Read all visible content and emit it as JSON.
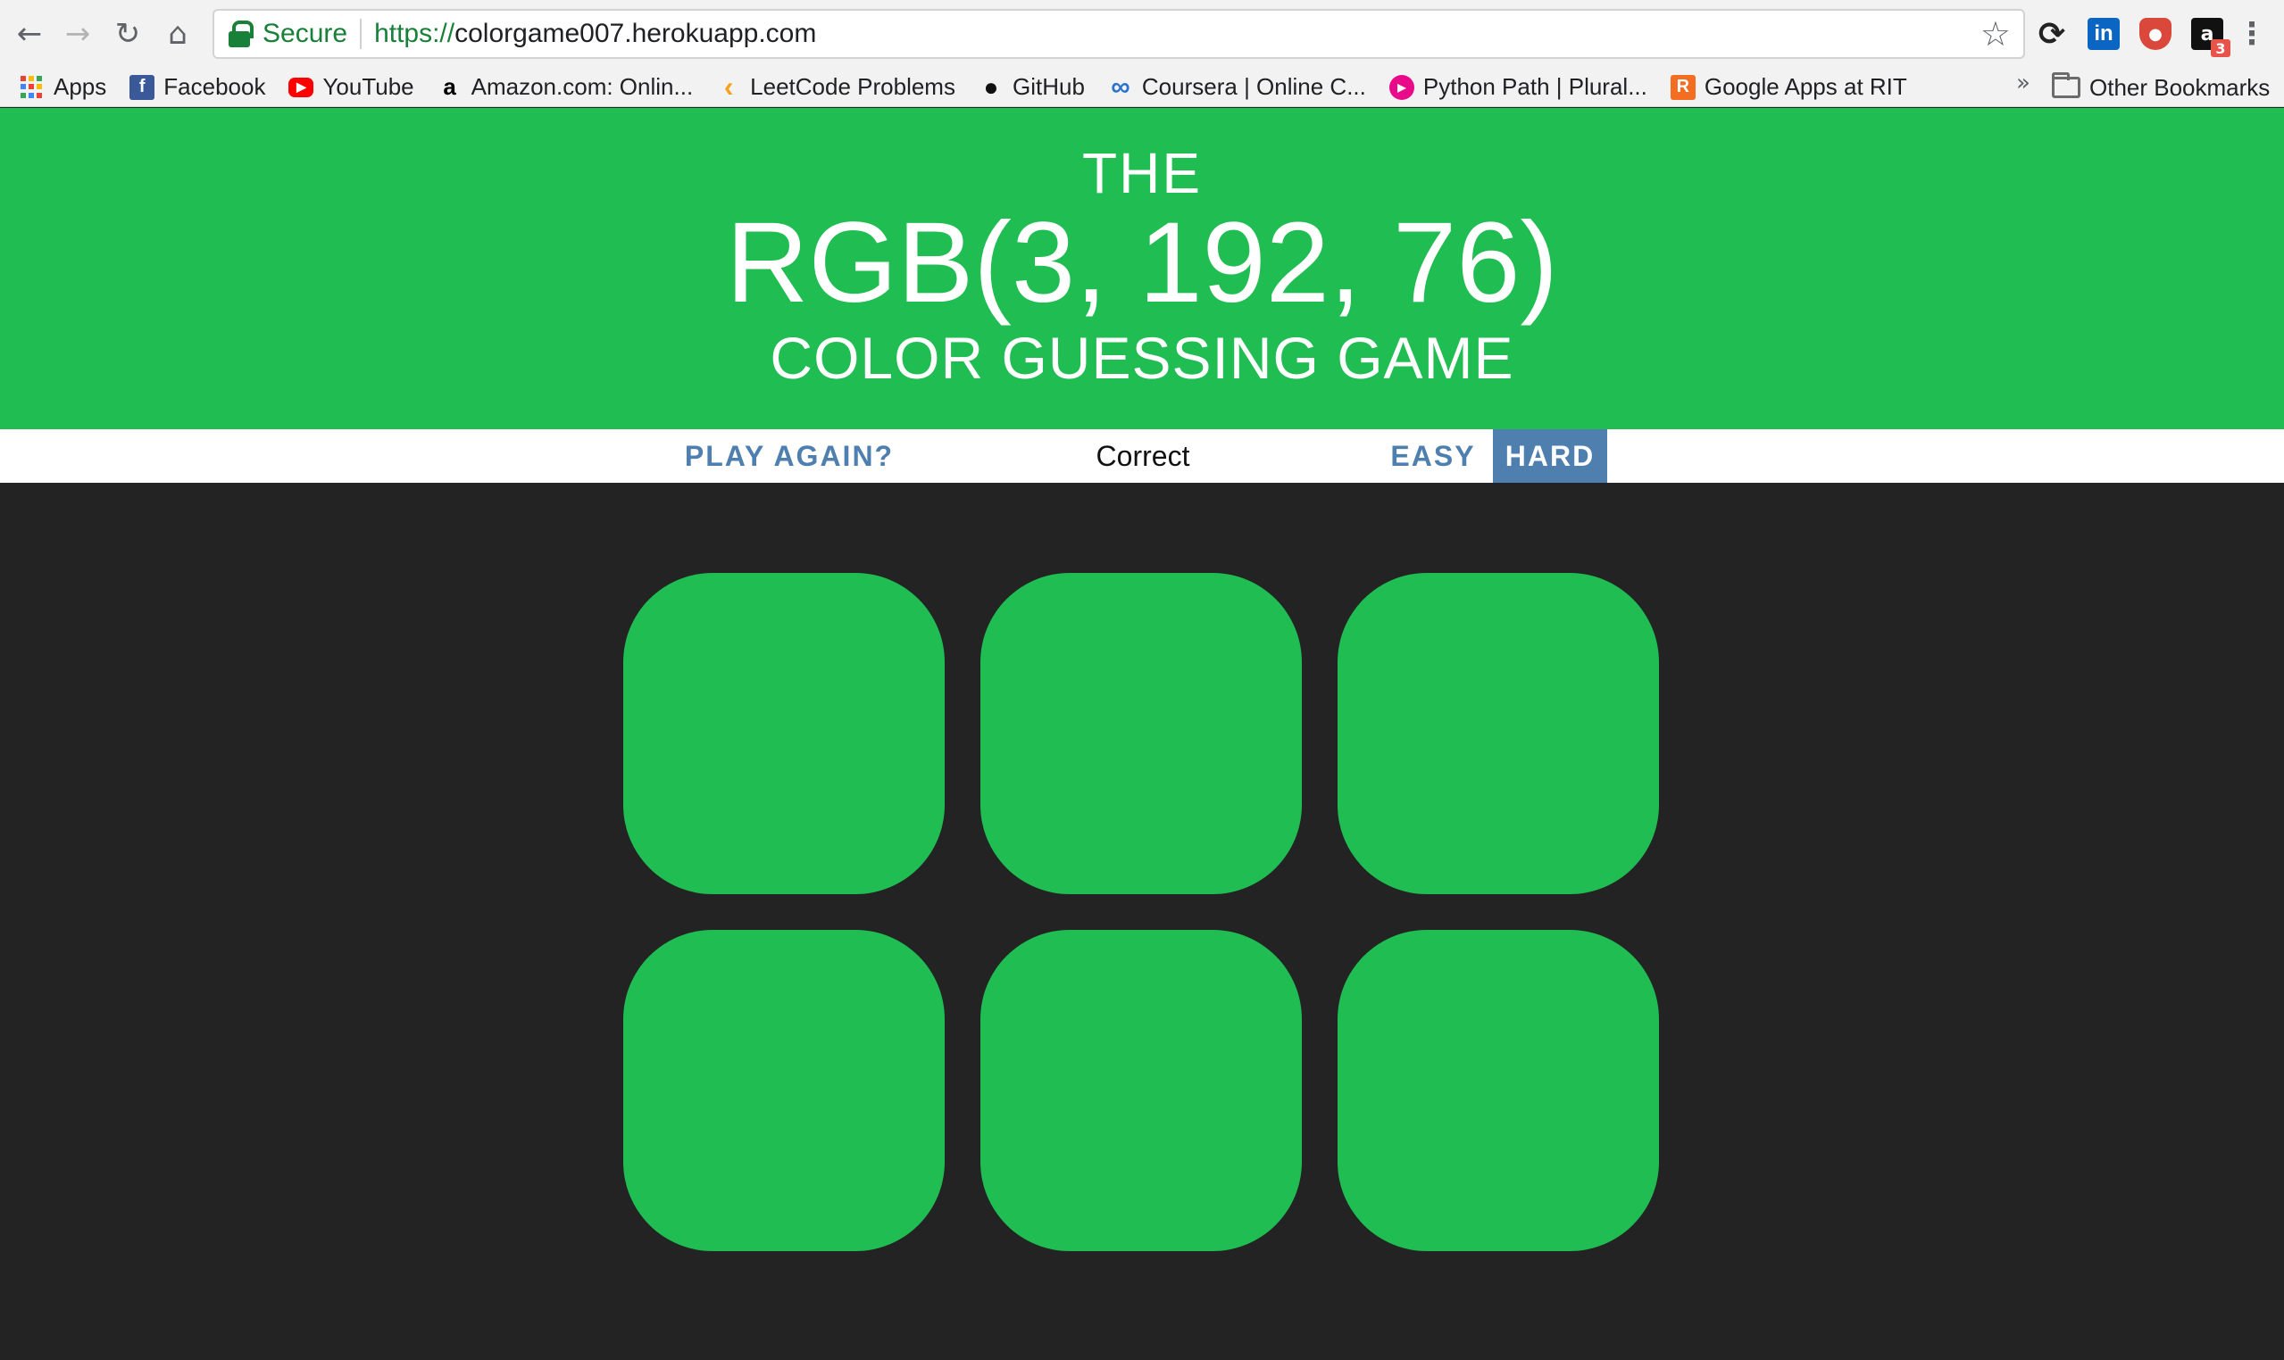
{
  "browser": {
    "secure_label": "Secure",
    "url_scheme": "https://",
    "url_host": "colorgame007.herokuapp.com",
    "icons": [
      "back-arrow-icon",
      "forward-arrow-icon",
      "reload-icon",
      "home-icon",
      "lock-icon",
      "star-icon",
      "sync-icon",
      "linkedin-icon",
      "shield-icon",
      "extension-icon",
      "menu-icon"
    ],
    "extension_badge": "3"
  },
  "bookmarks": [
    {
      "label": "Apps",
      "icon": "apps-grid-icon"
    },
    {
      "label": "Facebook",
      "icon": "facebook-icon",
      "icon_text": "f",
      "color": "#3b5998"
    },
    {
      "label": "YouTube",
      "icon": "youtube-icon",
      "icon_text": "▶",
      "color": "#ff0000"
    },
    {
      "label": "Amazon.com: Onlin...",
      "icon": "amazon-icon",
      "icon_text": "a",
      "color": "#000000"
    },
    {
      "label": "LeetCode Problems",
      "icon": "leetcode-icon",
      "icon_text": "‹",
      "color": "#f89f1b"
    },
    {
      "label": "GitHub",
      "icon": "github-icon",
      "icon_text": "●",
      "color": "#111111"
    },
    {
      "label": "Coursera | Online C...",
      "icon": "coursera-icon",
      "icon_text": "∞",
      "color": "#2a73cc"
    },
    {
      "label": "Python Path | Plural...",
      "icon": "pluralsight-icon",
      "icon_text": "▶",
      "color": "#e80a89"
    },
    {
      "label": "Google Apps at RIT",
      "icon": "rit-icon",
      "icon_text": "R",
      "color": "#f36e21"
    }
  ],
  "bookmarks_overflow": "»",
  "other_bookmarks": "Other Bookmarks",
  "game": {
    "title_the": "THE",
    "color_display": "RGB(3, 192, 76)",
    "title_sub": "COLOR GUESSING GAME",
    "reset_label": "PLAY AGAIN?",
    "message": "Correct",
    "easy_label": "EASY",
    "hard_label": "HARD",
    "selected_mode": "HARD",
    "header_color": "#1fbd52",
    "accent_color": "#4e7fae",
    "background_color": "#232323",
    "squares": [
      {
        "color": "#1fbd52"
      },
      {
        "color": "#1fbd52"
      },
      {
        "color": "#1fbd52"
      },
      {
        "color": "#1fbd52"
      },
      {
        "color": "#1fbd52"
      },
      {
        "color": "#1fbd52"
      }
    ]
  }
}
